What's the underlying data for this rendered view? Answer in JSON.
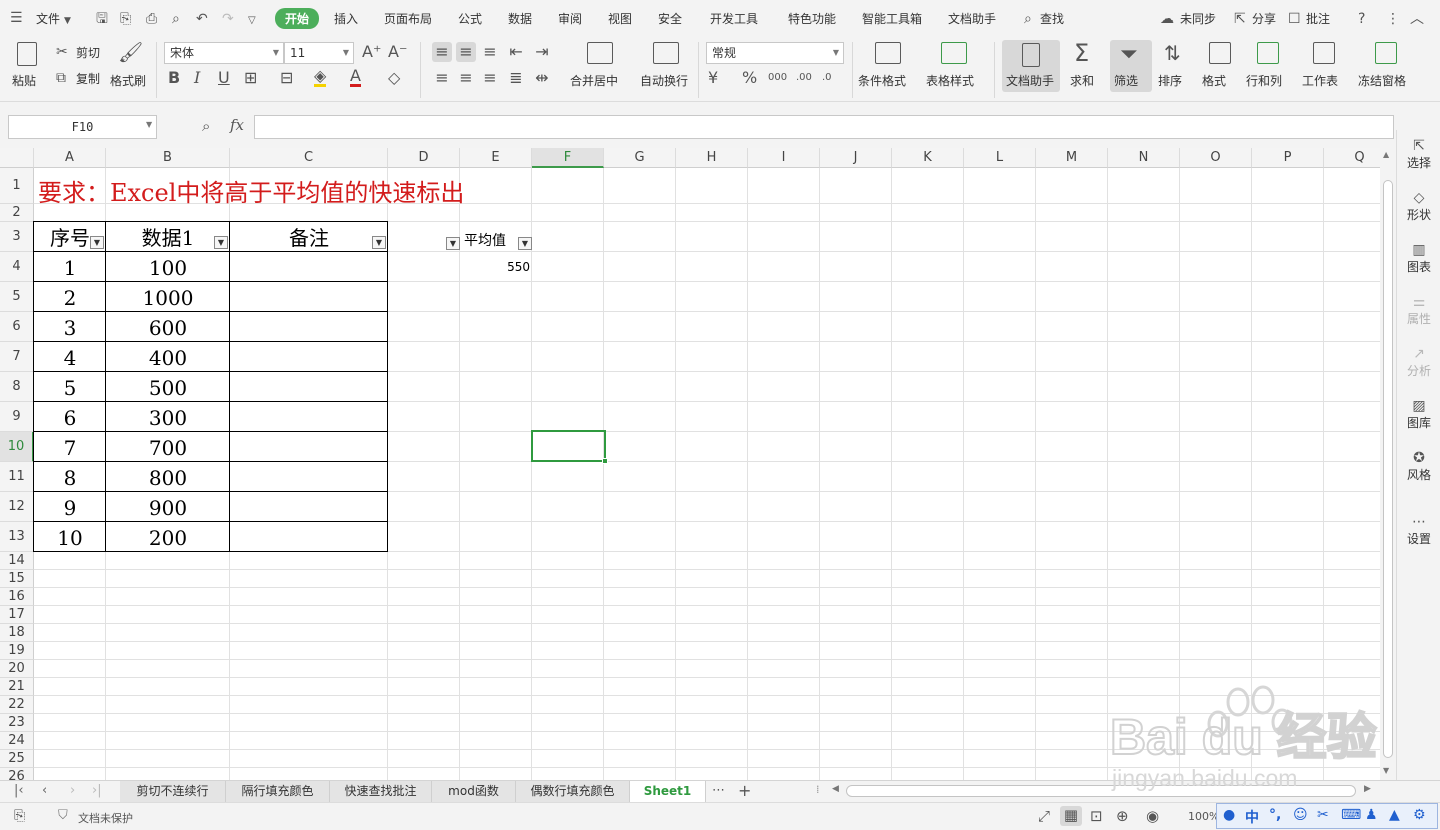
{
  "menubar": {
    "file": "文件",
    "tabs": [
      "开始",
      "插入",
      "页面布局",
      "公式",
      "数据",
      "审阅",
      "视图",
      "安全",
      "开发工具",
      "特色功能",
      "智能工具箱",
      "文档助手"
    ],
    "search": "查找",
    "sync": "未同步",
    "share": "分享",
    "comment": "批注"
  },
  "ribbon": {
    "paste": "粘贴",
    "cut": "剪切",
    "copy": "复制",
    "format_painter": "格式刷",
    "font_name": "宋体",
    "font_size": "11",
    "number_format": "常规",
    "merge_center": "合并居中",
    "wrap_text": "自动换行",
    "conditional_format": "条件格式",
    "table_style": "表格样式",
    "doc_assistant": "文档助手",
    "sum": "求和",
    "filter": "筛选",
    "sort": "排序",
    "format": "格式",
    "rows_cols": "行和列",
    "worksheet": "工作表",
    "freeze": "冻结窗格"
  },
  "formula_bar": {
    "name_box": "F10",
    "fx": "fx",
    "formula": ""
  },
  "grid": {
    "columns": [
      "A",
      "B",
      "C",
      "D",
      "E",
      "F",
      "G",
      "H",
      "I",
      "J",
      "K",
      "L",
      "M",
      "N",
      "O",
      "P",
      "Q"
    ],
    "rows": [
      "1",
      "2",
      "3",
      "4",
      "5",
      "6",
      "7",
      "8",
      "9",
      "10",
      "11",
      "12",
      "13",
      "14",
      "15",
      "16",
      "17",
      "18",
      "19",
      "20",
      "21",
      "22",
      "23",
      "24",
      "25",
      "26"
    ],
    "selected_cell": "F10"
  },
  "sheet": {
    "title": "要求：Excel中将高于平均值的快速标出",
    "headers": [
      "序号",
      "数据1",
      "备注"
    ],
    "rows": [
      [
        "1",
        "100",
        ""
      ],
      [
        "2",
        "1000",
        ""
      ],
      [
        "3",
        "600",
        ""
      ],
      [
        "4",
        "400",
        ""
      ],
      [
        "5",
        "500",
        ""
      ],
      [
        "6",
        "300",
        ""
      ],
      [
        "7",
        "700",
        ""
      ],
      [
        "8",
        "800",
        ""
      ],
      [
        "9",
        "900",
        ""
      ],
      [
        "10",
        "200",
        ""
      ]
    ],
    "average_label": "平均值",
    "average_value": "550"
  },
  "right_panel": [
    "选择",
    "形状",
    "图表",
    "属性",
    "分析",
    "图库",
    "风格",
    "设置"
  ],
  "sheet_tabs": [
    "剪切不连续行",
    "隔行填充颜色",
    "快速查找批注",
    "mod函数",
    "偶数行填充颜色",
    "Sheet1"
  ],
  "active_sheet": "Sheet1",
  "status": {
    "protect": "文档未保护",
    "zoom": "100%"
  },
  "watermark": {
    "brand": "Bai du 经验",
    "url": "jingyan.baidu.com"
  }
}
